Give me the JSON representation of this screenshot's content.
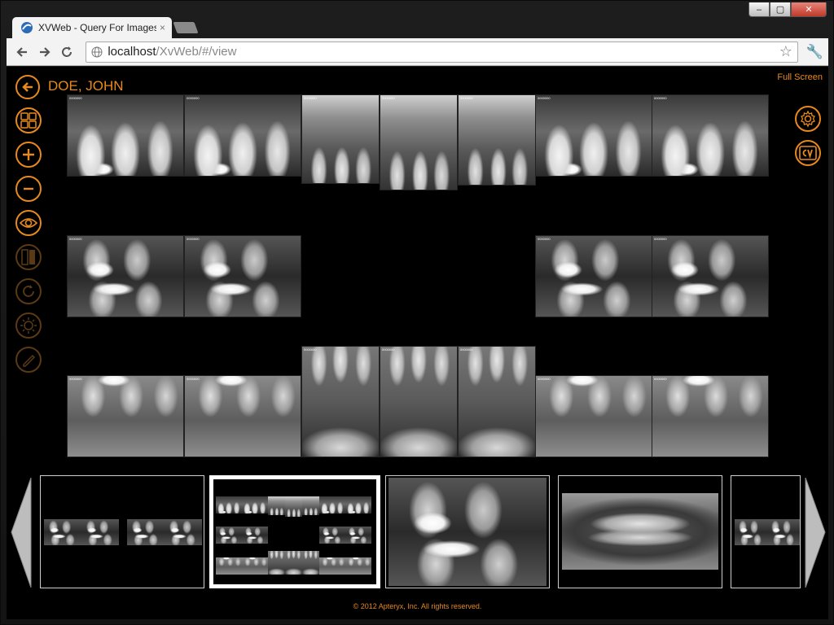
{
  "window": {
    "minimize": "‒",
    "maximize": "▢",
    "close": "✕"
  },
  "tab": {
    "title": "XVWeb - Query For Images",
    "close": "×"
  },
  "address": {
    "host": "localhost",
    "path": "/XvWeb/#/view"
  },
  "patient": {
    "name": "DOE, JOHN"
  },
  "header": {
    "fullscreen_label": "Full Screen"
  },
  "tools": {
    "left": [
      "grid-icon",
      "zoom-in-icon",
      "zoom-out-icon",
      "eye-icon",
      "compare-icon",
      "rotate-icon",
      "brightness-icon",
      "pencil-icon"
    ],
    "right": [
      "gear-icon",
      "cv-logo-icon"
    ]
  },
  "xray_tag": "0000000",
  "footer": {
    "copyright": "© 2012 Apteryx, Inc. All rights reserved."
  },
  "colors": {
    "accent": "#e8891e",
    "background": "#000000"
  }
}
